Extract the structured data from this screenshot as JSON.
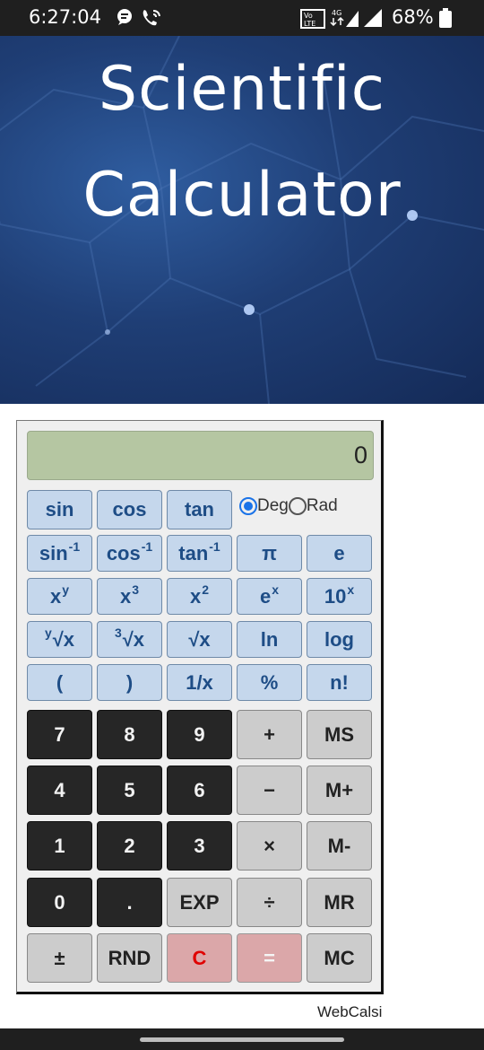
{
  "status_bar": {
    "time": "6:27:04",
    "network": "4G",
    "volte": "Vo LTE",
    "battery": "68%"
  },
  "hero": {
    "title_line1": "Scientific",
    "title_line2": "Calculator"
  },
  "display": {
    "value": "0"
  },
  "angle_mode": {
    "deg_label": "Deg",
    "rad_label": "Rad",
    "selected": "Deg"
  },
  "keys": {
    "sin": "sin",
    "cos": "cos",
    "tan": "tan",
    "asin_base": "sin",
    "asin_sup": "-1",
    "acos_base": "cos",
    "acos_sup": "-1",
    "atan_base": "tan",
    "atan_sup": "-1",
    "pi": "π",
    "e": "e",
    "xy_base": "x",
    "xy_sup": "y",
    "x3_base": "x",
    "x3_sup": "3",
    "x2_base": "x",
    "x2_sup": "2",
    "ex_base": "e",
    "ex_sup": "x",
    "tenx_base": "10",
    "tenx_sup": "x",
    "yroot_pre": "y",
    "yroot_base": "√x",
    "croot_pre": "3",
    "croot_base": "√x",
    "sqrt": "√x",
    "ln": "ln",
    "log": "log",
    "lparen": "(",
    "rparen": ")",
    "recip": "1/x",
    "percent": "%",
    "fact": "n!",
    "n7": "7",
    "n8": "8",
    "n9": "9",
    "plus": "+",
    "ms": "MS",
    "n4": "4",
    "n5": "5",
    "n6": "6",
    "minus": "−",
    "mplus": "M+",
    "n1": "1",
    "n2": "2",
    "n3": "3",
    "times": "×",
    "mminus": "M-",
    "n0": "0",
    "dot": ".",
    "exp": "EXP",
    "divide": "÷",
    "mr": "MR",
    "plusminus": "±",
    "rnd": "RND",
    "clear": "C",
    "equals": "=",
    "mc": "MC"
  },
  "footer": {
    "brand": "WebCalsi"
  }
}
